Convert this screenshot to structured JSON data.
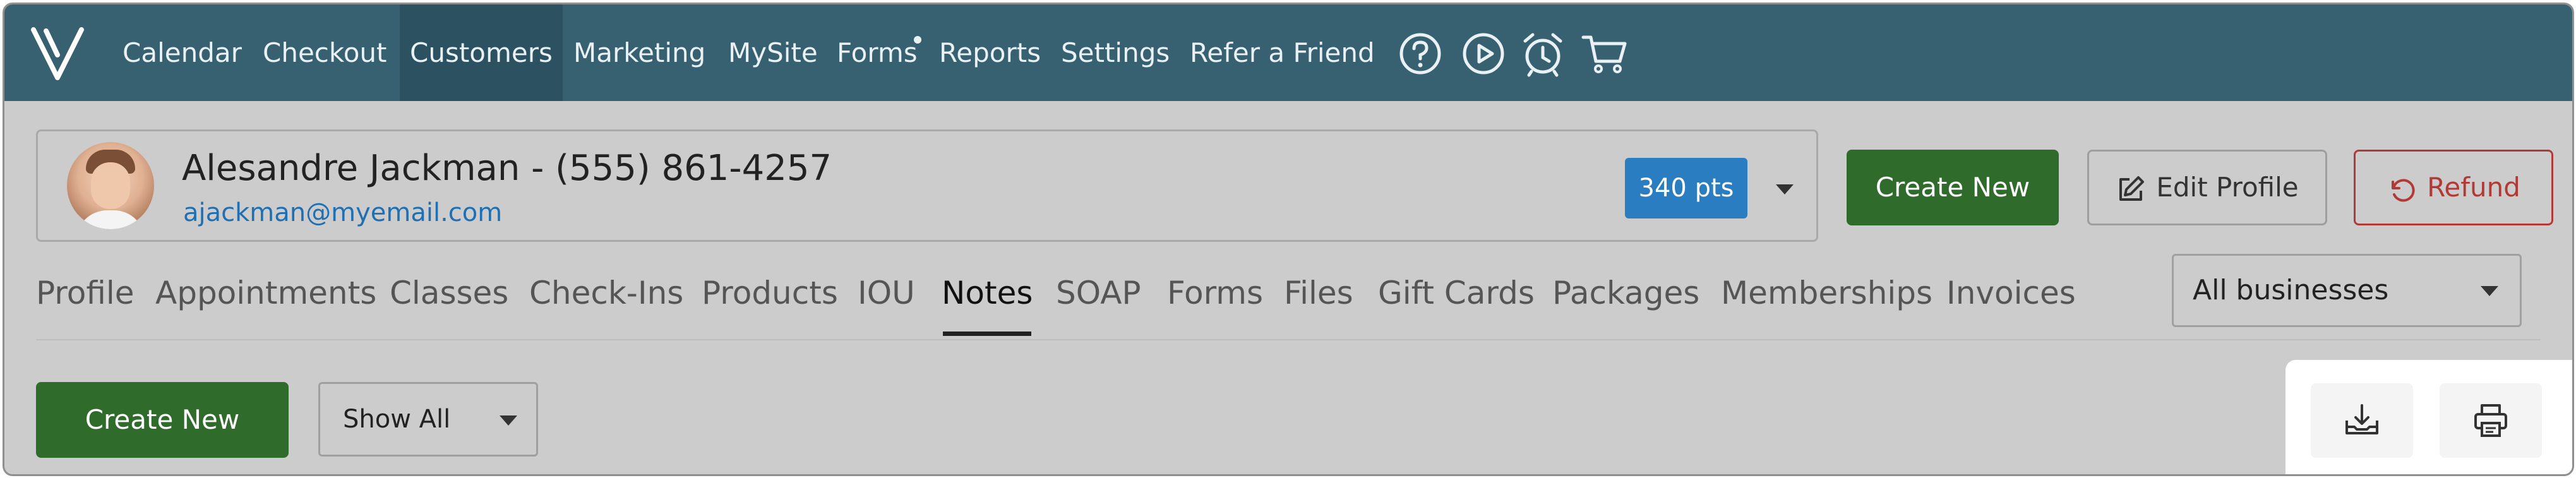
{
  "nav": {
    "items": [
      {
        "label": "Calendar"
      },
      {
        "label": "Checkout"
      },
      {
        "label": "Customers",
        "active": true
      },
      {
        "label": "Marketing"
      },
      {
        "label": "MySite"
      },
      {
        "label": "Forms",
        "dot": true
      },
      {
        "label": "Reports"
      },
      {
        "label": "Settings"
      },
      {
        "label": "Refer a Friend"
      }
    ],
    "icons": [
      "help-circle-icon",
      "play-circle-icon",
      "alarm-clock-icon",
      "cart-icon"
    ]
  },
  "customer": {
    "name_line": "Alesandre Jackman - (555) 861-4257",
    "email": "ajackman@myemail.com",
    "points": "340 pts"
  },
  "actions": {
    "create_new": "Create New",
    "edit_profile": "Edit Profile",
    "refund": "Refund"
  },
  "tabs": [
    {
      "label": "Profile"
    },
    {
      "label": "Appointments"
    },
    {
      "label": "Classes"
    },
    {
      "label": "Check-Ins"
    },
    {
      "label": "Products"
    },
    {
      "label": "IOU"
    },
    {
      "label": "Notes",
      "active": true
    },
    {
      "label": "SOAP"
    },
    {
      "label": "Forms"
    },
    {
      "label": "Files"
    },
    {
      "label": "Gift Cards"
    },
    {
      "label": "Packages"
    },
    {
      "label": "Memberships"
    },
    {
      "label": "Invoices"
    }
  ],
  "business_filter": {
    "selected": "All businesses"
  },
  "notes_toolbar": {
    "create_new": "Create New",
    "filter_selected": "Show All"
  },
  "colors": {
    "nav_bg": "#376070",
    "primary_green": "#2f6b2a",
    "points_blue": "#2b7dc1",
    "refund_red": "#b23a36",
    "link_blue": "#1f6fb3"
  }
}
